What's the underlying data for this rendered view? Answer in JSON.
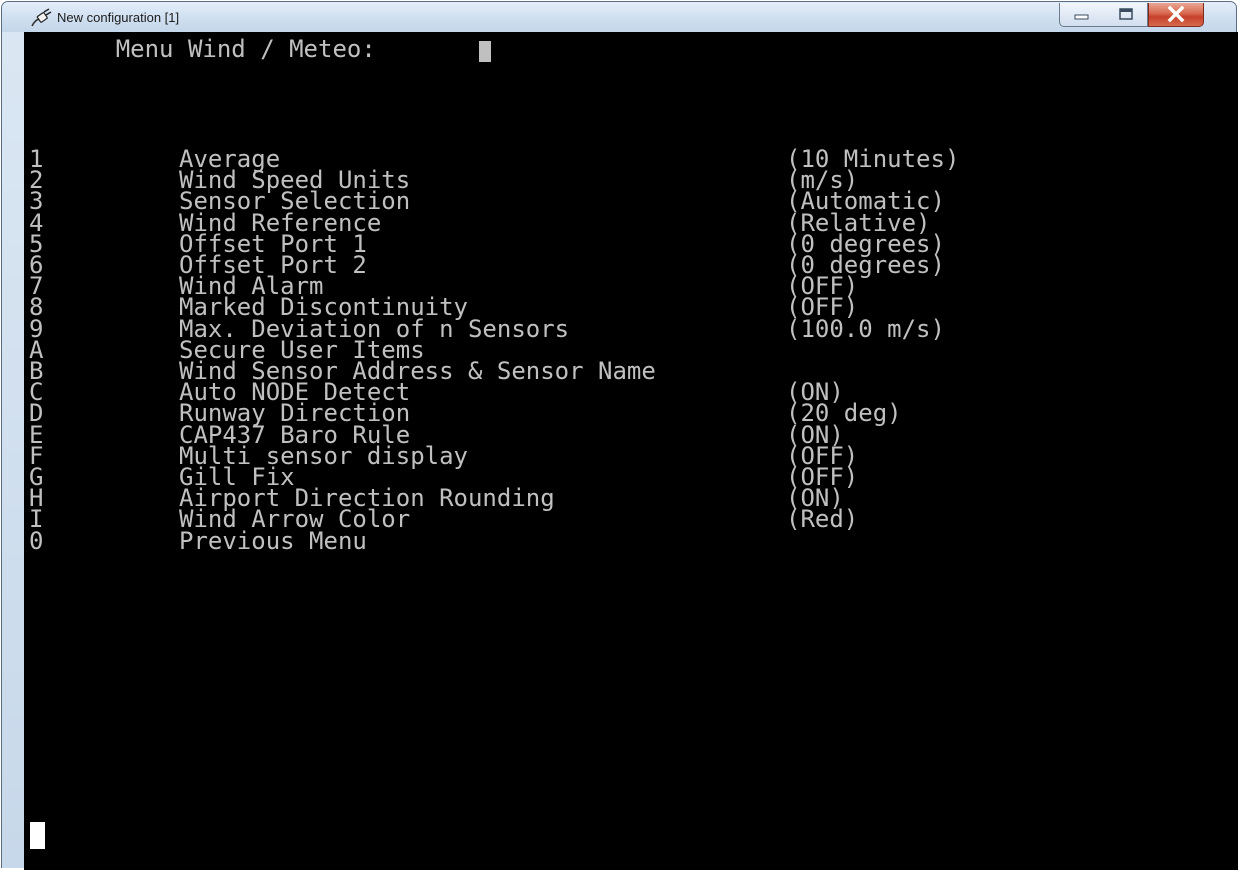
{
  "window": {
    "title": "New configuration [1]",
    "icons": {
      "app": "putty-plug-icon",
      "minimize": "minimize-icon",
      "maximize": "maximize-icon",
      "close": "close-icon"
    }
  },
  "terminal": {
    "menu_title": "Menu Wind / Meteo:",
    "items": [
      {
        "key": "1",
        "label": "Average",
        "value": "(10 Minutes)"
      },
      {
        "key": "2",
        "label": "Wind Speed Units",
        "value": "(m/s)"
      },
      {
        "key": "3",
        "label": "Sensor Selection",
        "value": "(Automatic)"
      },
      {
        "key": "4",
        "label": "Wind Reference",
        "value": "(Relative)"
      },
      {
        "key": "5",
        "label": "Offset Port 1",
        "value": "(0 degrees)"
      },
      {
        "key": "6",
        "label": "Offset Port 2",
        "value": "(0 degrees)"
      },
      {
        "key": "7",
        "label": "Wind Alarm",
        "value": "(OFF)"
      },
      {
        "key": "8",
        "label": "Marked Discontinuity",
        "value": "(OFF)"
      },
      {
        "key": "9",
        "label": "Max. Deviation of n Sensors",
        "value": "(100.0 m/s)"
      },
      {
        "key": "A",
        "label": "Secure User Items",
        "value": ""
      },
      {
        "key": "B",
        "label": "Wind Sensor Address & Sensor Name",
        "value": ""
      },
      {
        "key": "C",
        "label": "Auto NODE Detect",
        "value": "(ON)"
      },
      {
        "key": "D",
        "label": "Runway Direction",
        "value": "(20 deg)"
      },
      {
        "key": "E",
        "label": "CAP437 Baro Rule",
        "value": "(ON)"
      },
      {
        "key": "F",
        "label": "Multi sensor display",
        "value": "(OFF)"
      },
      {
        "key": "G",
        "label": "Gill Fix",
        "value": "(OFF)"
      },
      {
        "key": "H",
        "label": "Airport Direction Rounding",
        "value": "(ON)"
      },
      {
        "key": "I",
        "label": "Wind Arrow Color",
        "value": "(Red)"
      },
      {
        "key": "0",
        "label": "Previous Menu",
        "value": ""
      }
    ]
  }
}
